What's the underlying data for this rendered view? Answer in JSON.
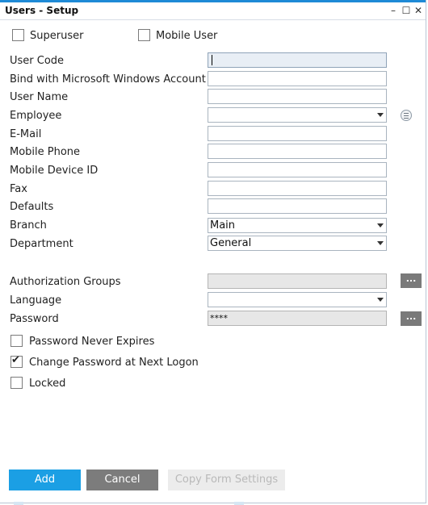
{
  "window": {
    "title": "Users - Setup",
    "controls": [
      "–",
      "☐",
      "✕"
    ]
  },
  "checkboxes_top": {
    "superuser": {
      "label": "Superuser",
      "checked": false
    },
    "mobile_user": {
      "label": "Mobile User",
      "checked": false
    }
  },
  "fields": {
    "user_code": {
      "label": "User Code",
      "value": ""
    },
    "bind_windows": {
      "label": "Bind with Microsoft Windows Account",
      "value": ""
    },
    "user_name": {
      "label": "User Name",
      "value": ""
    },
    "employee": {
      "label": "Employee",
      "value": ""
    },
    "email": {
      "label": "E-Mail",
      "value": ""
    },
    "mobile_phone": {
      "label": "Mobile Phone",
      "value": ""
    },
    "mobile_device_id": {
      "label": "Mobile Device ID",
      "value": ""
    },
    "fax": {
      "label": "Fax",
      "value": ""
    },
    "defaults": {
      "label": "Defaults",
      "value": ""
    },
    "branch": {
      "label": "Branch",
      "value": "Main"
    },
    "department": {
      "label": "Department",
      "value": "General"
    },
    "authorization_groups": {
      "label": "Authorization Groups",
      "value": ""
    },
    "language": {
      "label": "Language",
      "value": ""
    },
    "password": {
      "label": "Password",
      "value": "****"
    }
  },
  "dots_label": "...",
  "checkboxes_bottom": {
    "password_never_expires": {
      "label": "Password Never Expires",
      "checked": false
    },
    "change_password": {
      "label": "Change Password at Next Logon",
      "checked": true,
      "mark": "✔"
    },
    "locked": {
      "label": "Locked",
      "checked": false
    }
  },
  "buttons": {
    "add": "Add",
    "cancel": "Cancel",
    "copy": "Copy Form Settings"
  },
  "colors": {
    "accent": "#1b9fe4",
    "title_bar_line": "#1e8ad6"
  }
}
